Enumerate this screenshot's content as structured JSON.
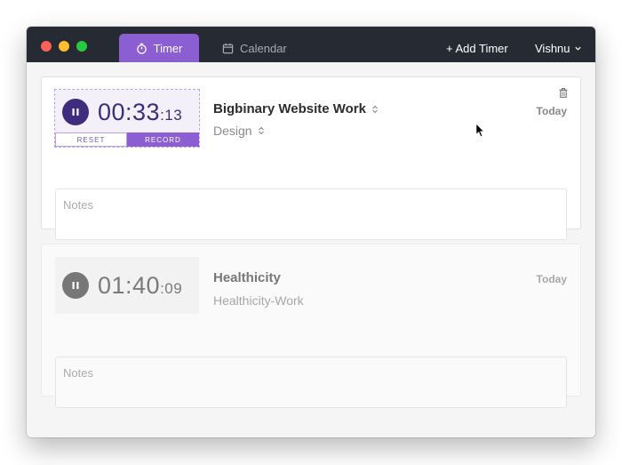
{
  "tabs": [
    {
      "label": "Timer",
      "icon": "stopwatch-icon",
      "active": true
    },
    {
      "label": "Calendar",
      "icon": "calendar-icon",
      "active": false
    }
  ],
  "header": {
    "add_timer_label": "+ Add Timer",
    "user_name": "Vishnu"
  },
  "colors": {
    "accent": "#8b5fd1",
    "dark_purple": "#3e2d7d",
    "titlebar": "#262a33"
  },
  "timers": [
    {
      "state": "running",
      "time_main": "00:33",
      "time_secs": ":13",
      "reset_label": "RESET",
      "record_label": "RECORD",
      "project": "Bigbinary Website Work",
      "task": "Design",
      "date": "Today",
      "notes_placeholder": "Notes",
      "notes_value": ""
    },
    {
      "state": "paused",
      "time_main": "01:40",
      "time_secs": ":09",
      "project": "Healthicity",
      "task": "Healthicity-Work",
      "date": "Today",
      "notes_placeholder": "Notes",
      "notes_value": ""
    }
  ]
}
